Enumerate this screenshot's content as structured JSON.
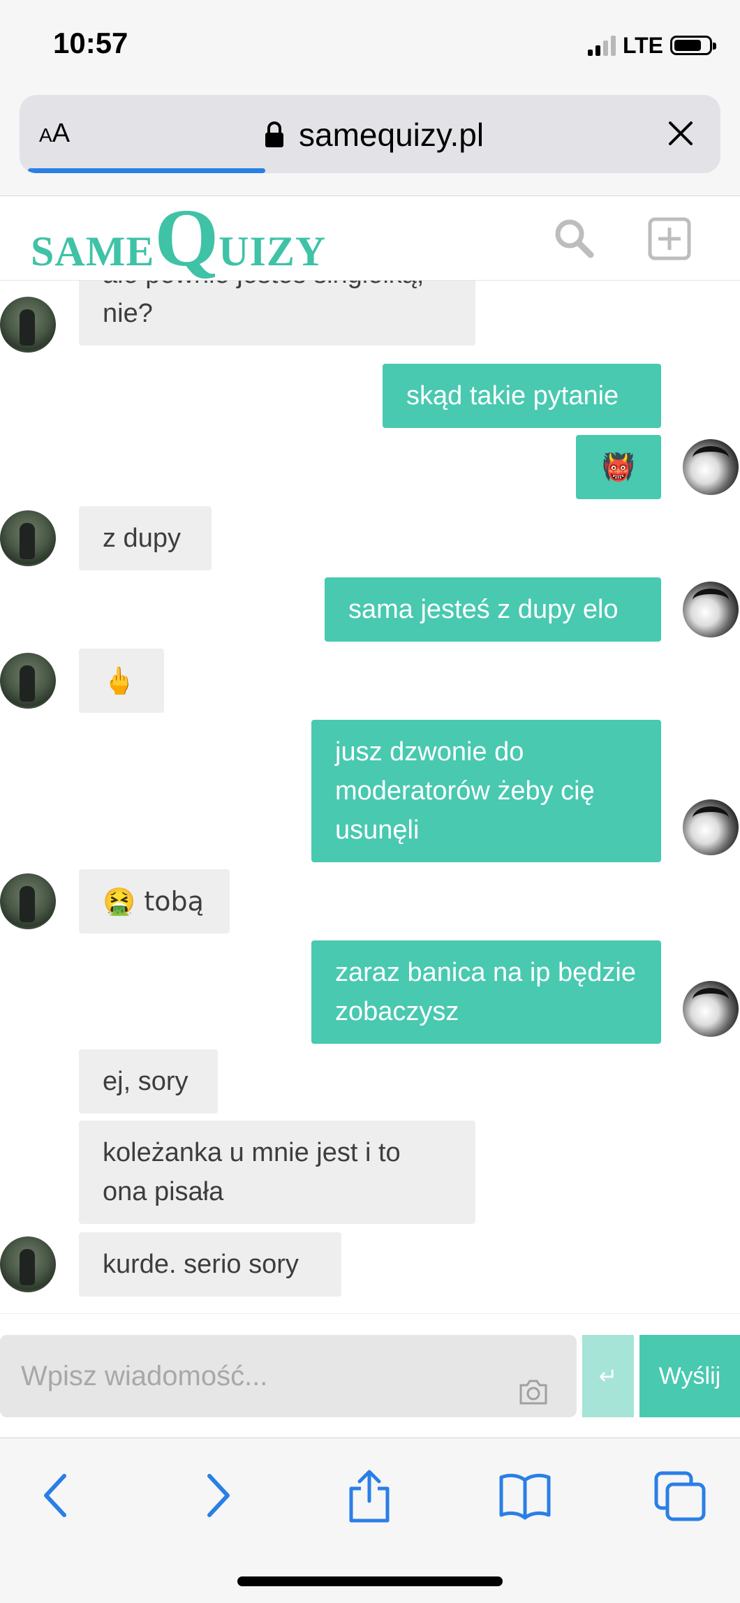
{
  "status_bar": {
    "time": "10:57",
    "network": "LTE"
  },
  "browser": {
    "aa_small": "A",
    "aa_big": "A",
    "url": "samequizy.pl",
    "load_progress": 0.3
  },
  "site": {
    "logo_same": "SAME",
    "logo_q": "Q",
    "logo_uizy": "UIZY",
    "brand_color": "#48c9b0"
  },
  "messages": [
    {
      "side": "recv",
      "text": "ale pewnie jesteś singielką, nie?"
    },
    {
      "side": "sent",
      "text": "skąd takie pytanie"
    },
    {
      "side": "sent",
      "text": "👹"
    },
    {
      "side": "recv",
      "text": "z dupy"
    },
    {
      "side": "sent",
      "text": "sama jesteś z dupy elo"
    },
    {
      "side": "recv",
      "text": "🖕"
    },
    {
      "side": "sent",
      "text": "jusz dzwonie do moderatorów żeby cię usunęli"
    },
    {
      "side": "recv",
      "text": "🤮 tobą"
    },
    {
      "side": "sent",
      "text": "zaraz banica na ip będzie zobaczysz"
    },
    {
      "side": "recv",
      "text": "ej, sory"
    },
    {
      "side": "recv",
      "text": "koleżanka u mnie jest i to ona pisała"
    },
    {
      "side": "recv",
      "text": "kurde. serio sory"
    }
  ],
  "composer": {
    "placeholder": "Wpisz wiadomość...",
    "enter_symbol": "↵",
    "send_label": "Wyślij"
  },
  "icons": {
    "lock": "lock-icon",
    "close": "close-icon",
    "search": "search-icon",
    "add": "add-quiz-icon",
    "camera": "camera-icon",
    "back": "back-icon",
    "forward": "forward-icon",
    "share": "share-icon",
    "bookmarks": "bookmarks-icon",
    "tabs": "tabs-icon"
  }
}
